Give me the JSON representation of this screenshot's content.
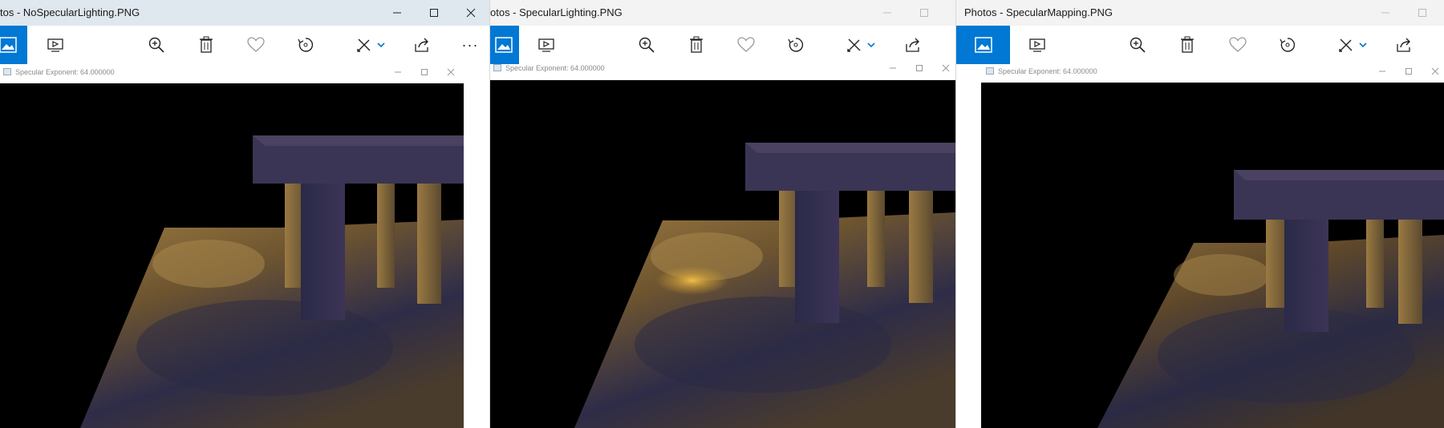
{
  "windows": [
    {
      "title": "tos - NoSpecularLighting.PNG",
      "subwindow_title": "Specular Exponent: 64.000000",
      "specular_highlight": false
    },
    {
      "title": "otos - SpecularLighting.PNG",
      "subwindow_title": "Specular Exponent: 64.000000",
      "specular_highlight": true
    },
    {
      "title": "Photos - SpecularMapping.PNG",
      "subwindow_title": "Specular Exponent: 64.000000",
      "specular_highlight": false
    }
  ],
  "toolbar": {
    "icons": [
      "photo-icon",
      "slideshow-icon",
      "zoom-in-icon",
      "delete-icon",
      "favorite-icon",
      "rotate-icon",
      "edit-icon",
      "share-icon",
      "more-icon"
    ],
    "more_label": "···"
  },
  "colors": {
    "accent": "#0078d4",
    "titlebar_active": "#ffffff",
    "titlebar_inactive": "#f3f3f3",
    "scene_background": "#000000",
    "stone_dark": "#2a2a4a",
    "stone_light": "#b08a48"
  }
}
